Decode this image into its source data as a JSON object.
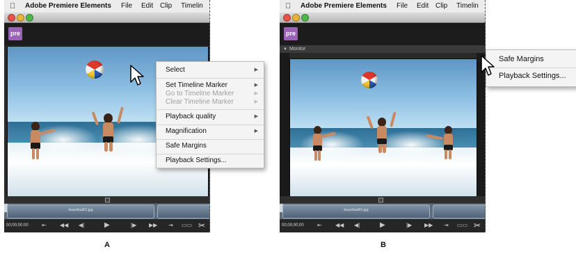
{
  "screenshots": [
    {
      "caption": "A",
      "app_menu": {
        "apple": "",
        "app_name": "Adobe Premiere Elements",
        "items": [
          "File",
          "Edit",
          "Clip",
          "Timelin"
        ]
      },
      "app_badge": "pre",
      "clip_name": "beachball01.jpg",
      "timecode": "00;00;00;00",
      "context_menu": [
        {
          "label": "Select",
          "submenu": true,
          "enabled": true
        },
        {
          "label": "Set Timeline Marker",
          "submenu": true,
          "enabled": true
        },
        {
          "label": "Go to Timeline Marker",
          "submenu": true,
          "enabled": false
        },
        {
          "label": "Clear Timeline Marker",
          "submenu": true,
          "enabled": false
        },
        {
          "label": "Playback quality",
          "submenu": true,
          "enabled": true
        },
        {
          "label": "Magnification",
          "submenu": true,
          "enabled": true
        },
        {
          "label": "Safe Margins",
          "submenu": false,
          "enabled": true
        },
        {
          "label": "Playback Settings...",
          "submenu": false,
          "enabled": true
        }
      ]
    },
    {
      "caption": "B",
      "app_menu": {
        "apple": "",
        "app_name": "Adobe Premiere Elements",
        "items": [
          "File",
          "Edit",
          "Clip",
          "Timelin"
        ]
      },
      "app_badge": "pre",
      "panel_title": "Monitor",
      "clip_name": "beachball01.jpg",
      "timecode": "00;00;00;00",
      "context_menu": [
        {
          "label": "Safe Margins"
        },
        {
          "label": "Playback Settings..."
        }
      ]
    }
  ],
  "icons": {
    "submenu_arrow": "▶",
    "play": "▶",
    "step_back": "◀◀",
    "step_forward": "▶▶",
    "scissors": "✂"
  },
  "colors": {
    "app_badge": "#9a63b8",
    "menu_bg": "#f4f4f4",
    "panel_bg": "#2a2a2a"
  }
}
